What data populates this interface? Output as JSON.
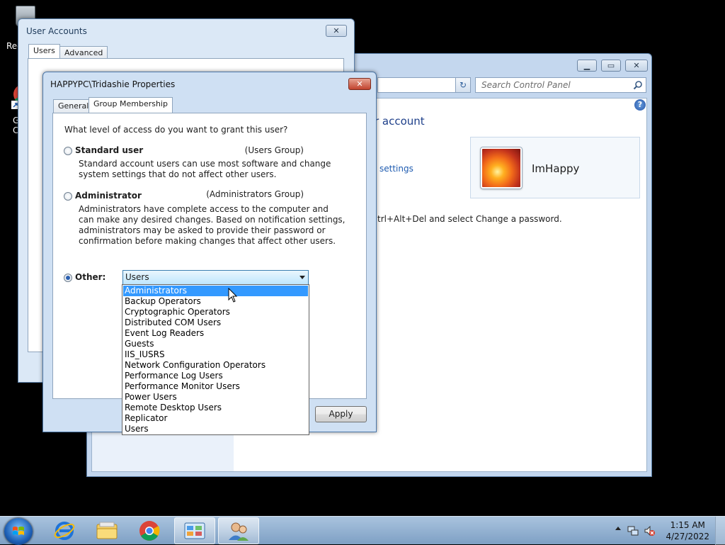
{
  "desktop": {
    "recycle_label": "Rec",
    "chrome_label_1": "G",
    "chrome_label_2": "C"
  },
  "control_panel": {
    "search_placeholder": "Search Control Panel",
    "heading": "r account",
    "link": "settings",
    "note": "trl+Alt+Del and select Change a password.",
    "username": "ImHappy"
  },
  "user_accounts": {
    "title": "User Accounts",
    "tabs": [
      "Users",
      "Advanced"
    ]
  },
  "properties": {
    "title": "HAPPYPC\\Tridashie Properties",
    "tabs": [
      "General",
      "Group Membership"
    ],
    "question": "What level of access do you want to grant this user?",
    "standard": {
      "title": "Standard user",
      "group": "(Users Group)",
      "desc": [
        "Standard account users can use most software and change",
        "system settings that do not affect other users."
      ]
    },
    "admin": {
      "title": "Administrator",
      "group": "(Administrators Group)",
      "desc": [
        "Administrators have complete access to the computer and",
        "can make any desired changes. Based on notification settings,",
        "administrators may be asked to provide their password or",
        "confirmation before making changes that affect other users."
      ]
    },
    "other_label": "Other:",
    "other_value": "Users",
    "apply_label": "Apply",
    "selected_option": "other"
  },
  "dropdown": {
    "items": [
      "Administrators",
      "Backup Operators",
      "Cryptographic Operators",
      "Distributed COM Users",
      "Event Log Readers",
      "Guests",
      "IIS_IUSRS",
      "Network Configuration Operators",
      "Performance Log Users",
      "Performance Monitor Users",
      "Power Users",
      "Remote Desktop Users",
      "Replicator",
      "Users"
    ],
    "highlighted": "Administrators"
  },
  "taskbar": {
    "time": "1:15 AM",
    "date": "4/27/2022",
    "pinned": [
      "start-button",
      "internet-explorer-icon",
      "file-explorer-icon",
      "chrome-icon",
      "control-panel-icon",
      "user-accounts-icon"
    ]
  },
  "colors": {
    "selection": "#3399ff",
    "link": "#1e5bb0",
    "heading": "#1e3f8a"
  }
}
